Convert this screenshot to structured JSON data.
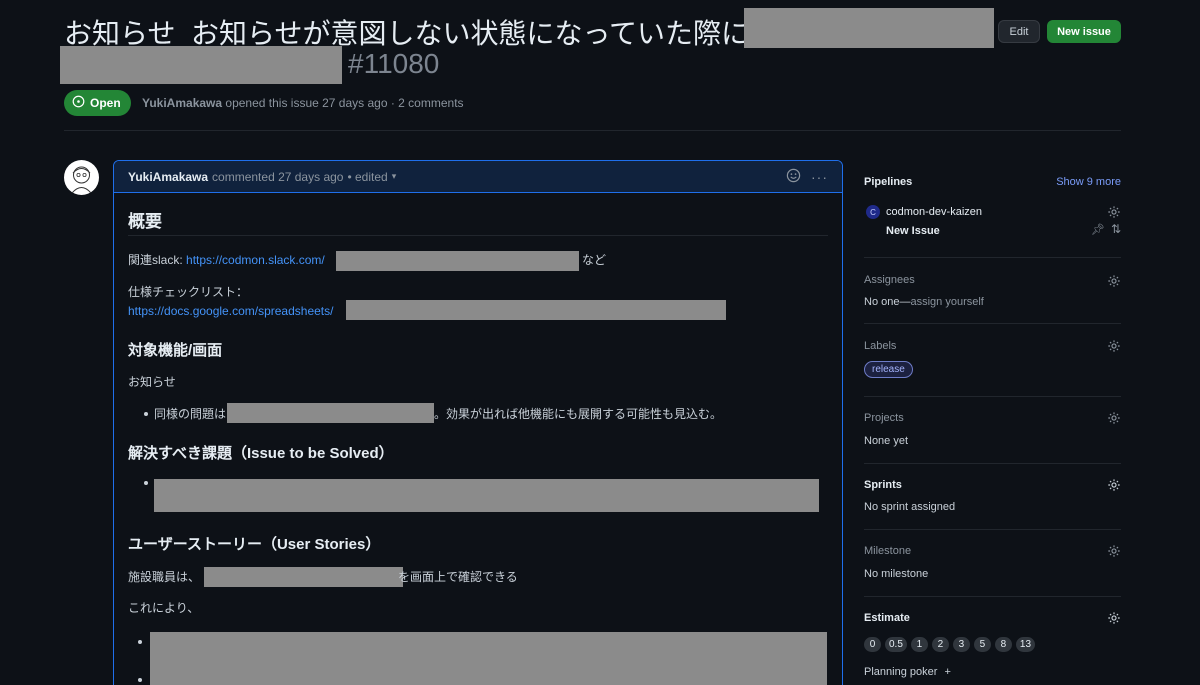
{
  "header": {
    "title_line1": "お知らせ_お知らせが意図しない状態になっていた際に",
    "issue_number": "#11080",
    "edit_label": "Edit",
    "new_issue_label": "New issue",
    "state_label": "Open",
    "author": "YukiAmakawa",
    "meta_text": "opened this issue 27 days ago · 2 comments"
  },
  "comment": {
    "author": "YukiAmakawa",
    "meta": "commented 27 days ago",
    "edited": "• edited",
    "body": {
      "h_overview": "概要",
      "related_slack_label": "関連slack:",
      "related_slack_link": "https://codmon.slack.com/",
      "related_slack_suffix": "など",
      "spec_checklist_label": "仕様チェックリスト：",
      "spec_checklist_link": "https://docs.google.com/spreadsheets/",
      "h_target": "対象機能/画面",
      "target_text": "お知らせ",
      "target_bullet_prefix": "同様の問題は",
      "target_bullet_suffix": "。効果が出れば他機能にも展開する可能性も見込む。",
      "h_problem": "解決すべき課題（Issue to be Solved）",
      "h_stories": "ユーザーストーリー（User Stories）",
      "story_prefix": "施設職員は、",
      "story_suffix": "を画面上で確認できる",
      "thereby": "これにより、"
    }
  },
  "sidebar": {
    "pipelines": {
      "title": "Pipelines",
      "show_more": "Show 9 more",
      "repo_initial": "C",
      "repo_name": "codmon-dev-kaizen",
      "pipeline_name": "New Issue"
    },
    "assignees": {
      "title": "Assignees",
      "value_prefix": "No one—",
      "value_link": "assign yourself"
    },
    "labels": {
      "title": "Labels",
      "items": [
        "release"
      ]
    },
    "projects": {
      "title": "Projects",
      "value": "None yet"
    },
    "sprints": {
      "title": "Sprints",
      "value": "No sprint assigned"
    },
    "milestone": {
      "title": "Milestone",
      "value": "No milestone"
    },
    "estimate": {
      "title": "Estimate",
      "options": [
        "0",
        "0.5",
        "1",
        "2",
        "3",
        "5",
        "8",
        "13"
      ]
    },
    "planning_poker": {
      "label": "Planning poker",
      "add": "+"
    }
  },
  "colors": {
    "background": "#0d1117",
    "accent_green": "#238636",
    "link_blue": "#4493f8",
    "comment_border": "#1f6feb",
    "redaction": "#8b8b8b"
  }
}
